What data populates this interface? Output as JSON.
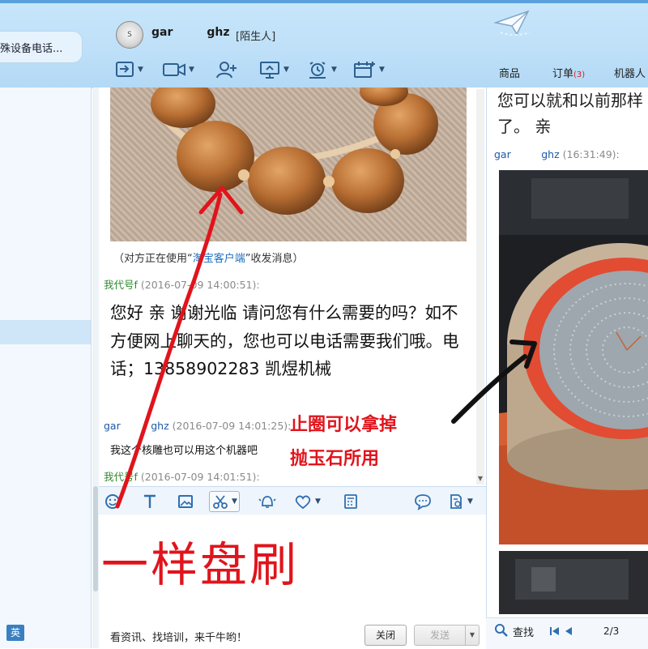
{
  "header": {
    "left_search_text": "殊设备电话...",
    "avatar_text": "S",
    "contact_name": "gar   ghz",
    "contact_tag": "[陌生人]",
    "right_tabs": [
      {
        "label": "商品"
      },
      {
        "label": "订单",
        "badge": "(3)"
      },
      {
        "label": "机器人"
      }
    ]
  },
  "chat": {
    "notice_prefix": "（对方正在使用“",
    "notice_link": "淘宝客户端",
    "notice_suffix": "”收发消息）",
    "messages": [
      {
        "sender": "我代号f",
        "time": "(2016-07-09 14:00:51):",
        "text": "您好 亲 谢谢光临  请问您有什么需要的吗？如不方便网上聊天的，您也可以电话需要我们哦。电话；13858902283 凯煜机械"
      },
      {
        "sender": "gar   ghz",
        "time": "(2016-07-09 14:01:25):",
        "text": "我这个核雕也可以用这个机器吧"
      },
      {
        "sender": "我代号f",
        "time": "(2016-07-09 14:01:51):",
        "text": ""
      }
    ]
  },
  "footer": {
    "ad_text": "看资讯、找培训，来千牛哟！",
    "close_label": "关闭",
    "send_label": "发送"
  },
  "right_panel": {
    "top_text": "您可以就和以前那样了。 亲",
    "sender": "gar   ghz",
    "time": "(16:31:49):",
    "find_label": "查找",
    "page_indicator": "2/3"
  },
  "annotations": {
    "big_text": "一样盘刷",
    "right_line1": "止圈可以拿掉",
    "right_line2": "抛玉石所用"
  },
  "colors": {
    "header_bg": "#c1e1f9",
    "annotation_red": "#e0141c",
    "green_sender": "#2f8a2f",
    "blue_sender": "#1e58a8",
    "link_blue": "#1b6dbf"
  }
}
